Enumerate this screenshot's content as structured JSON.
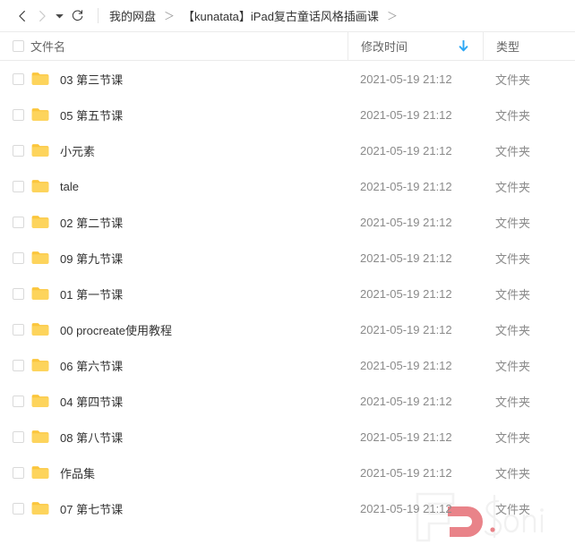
{
  "toolbar": {
    "back_label": "后退",
    "forward_label": "前进",
    "history_label": "历史记录",
    "refresh_label": "刷新"
  },
  "breadcrumb": {
    "separator": "＞",
    "items": [
      {
        "label": "我的网盘"
      },
      {
        "label": "【kunatata】iPad复古童话风格插画课"
      }
    ],
    "trailing_separator": "＞"
  },
  "columns": {
    "name": "文件名",
    "modified": "修改时间",
    "type": "类型",
    "sort_direction": "desc",
    "sort_color": "#2ba7f5"
  },
  "colors": {
    "folder_top": "#fbc93a",
    "folder_body": "#fdd košt",
    "accent": "#2ba7f5",
    "text": "#333333",
    "muted": "#8a8a8a",
    "border": "#ebebeb",
    "watermark_pink": "#e8797f",
    "watermark_gray": "#efefef"
  },
  "files": [
    {
      "name": "03 第三节课",
      "modified": "2021-05-19 21:12",
      "type": "文件夹",
      "icon": "folder-icon",
      "checked": false
    },
    {
      "name": "05 第五节课",
      "modified": "2021-05-19 21:12",
      "type": "文件夹",
      "icon": "folder-icon",
      "checked": false
    },
    {
      "name": "小元素",
      "modified": "2021-05-19 21:12",
      "type": "文件夹",
      "icon": "folder-icon",
      "checked": false
    },
    {
      "name": "tale",
      "modified": "2021-05-19 21:12",
      "type": "文件夹",
      "icon": "folder-icon",
      "checked": false
    },
    {
      "name": "02 第二节课",
      "modified": "2021-05-19 21:12",
      "type": "文件夹",
      "icon": "folder-icon",
      "checked": false
    },
    {
      "name": "09 第九节课",
      "modified": "2021-05-19 21:12",
      "type": "文件夹",
      "icon": "folder-icon",
      "checked": false
    },
    {
      "name": "01 第一节课",
      "modified": "2021-05-19 21:12",
      "type": "文件夹",
      "icon": "folder-icon",
      "checked": false
    },
    {
      "name": "00 procreate使用教程",
      "modified": "2021-05-19 21:12",
      "type": "文件夹",
      "icon": "folder-icon",
      "checked": false
    },
    {
      "name": "06 第六节课",
      "modified": "2021-05-19 21:12",
      "type": "文件夹",
      "icon": "folder-icon",
      "checked": false
    },
    {
      "name": "04 第四节课",
      "modified": "2021-05-19 21:12",
      "type": "文件夹",
      "icon": "folder-icon",
      "checked": false
    },
    {
      "name": "08 第八节课",
      "modified": "2021-05-19 21:12",
      "type": "文件夹",
      "icon": "folder-icon",
      "checked": false
    },
    {
      "name": "作品集",
      "modified": "2021-05-19 21:12",
      "type": "文件夹",
      "icon": "folder-icon",
      "checked": false
    },
    {
      "name": "07 第七节课",
      "modified": "2021-05-19 21:12",
      "type": "文件夹",
      "icon": "folder-icon",
      "checked": false
    }
  ],
  "select_all": {
    "checked": false
  }
}
